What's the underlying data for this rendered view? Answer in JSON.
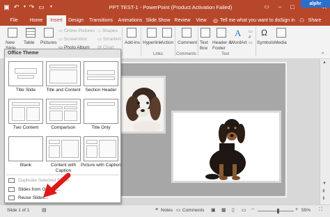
{
  "window": {
    "title": "PPT TEST-1 - PowerPoint (Product Activation Failed)",
    "watermark": "alphr",
    "controls": [
      "−",
      "□",
      "✕"
    ]
  },
  "quick_access": [
    "save-icon",
    "undo-icon",
    "redo-icon",
    "present-icon",
    "customize-icon"
  ],
  "tabs": [
    {
      "label": "File",
      "active": false
    },
    {
      "label": "Home",
      "active": false
    },
    {
      "label": "Insert",
      "active": true
    },
    {
      "label": "Design",
      "active": false
    },
    {
      "label": "Transitions",
      "active": false
    },
    {
      "label": "Animations",
      "active": false
    },
    {
      "label": "Slide Show",
      "active": false
    },
    {
      "label": "Review",
      "active": false
    },
    {
      "label": "View",
      "active": false
    },
    {
      "label": "Tell me what you want to do...",
      "active": false
    },
    {
      "label": "Sign in",
      "active": false
    },
    {
      "label": "Share",
      "active": false
    }
  ],
  "ribbon": {
    "new_slide": "New Slide",
    "table": "Table",
    "pictures": "Pictures",
    "online_pictures": "Online Pictures",
    "screenshot": "Screenshot",
    "photo_album": "Photo Album",
    "shapes": "Shapes",
    "smartart": "SmartArt",
    "chart": "Chart",
    "addins": "Add-ins",
    "hyperlink": "Hyperlink",
    "action": "Action",
    "comment": "Comment",
    "text_box": "Text Box",
    "header_footer": "Header & Footer",
    "wordart": "WordArt",
    "symbols": "Symbols",
    "media": "Media",
    "group_links": "Links",
    "group_comments": "Comments",
    "group_text": "Text"
  },
  "gallery": {
    "header": "Office Theme",
    "layouts": [
      "Title Slide",
      "Title and Content",
      "Section Header",
      "Two Content",
      "Comparison",
      "Title Only",
      "Blank",
      "Content with Caption",
      "Picture with Caption"
    ],
    "menu": [
      "Duplicate Selected Slides",
      "Slides from Outline...",
      "Reuse Slides..."
    ]
  },
  "status": {
    "slide": "Slide 1 of 1",
    "notes": "Notes",
    "comments": "Comments",
    "zoom": "55%"
  }
}
